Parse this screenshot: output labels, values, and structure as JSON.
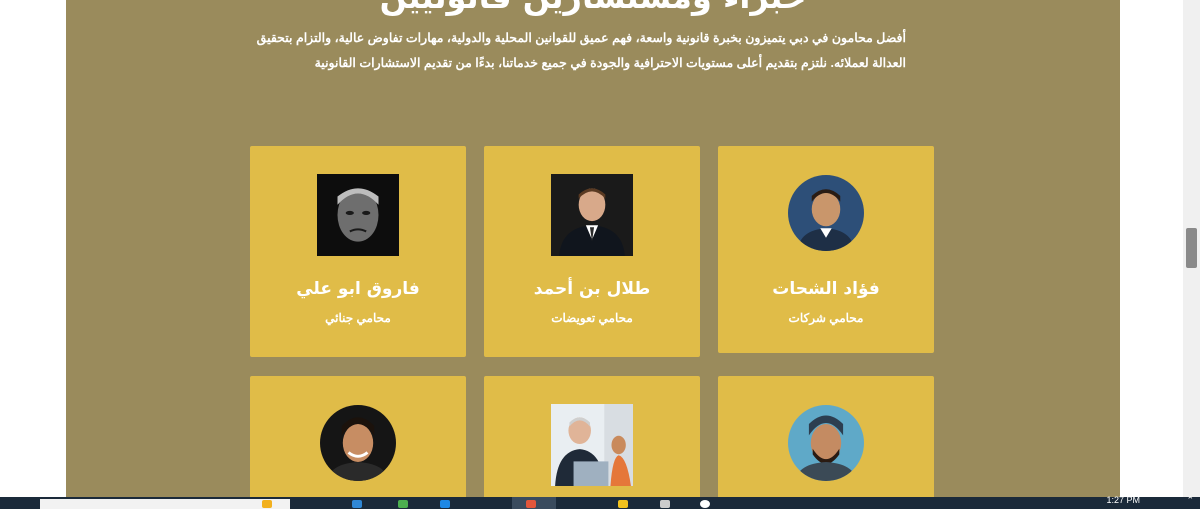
{
  "section": {
    "heading": "خبراء ومستشارين قانونيين",
    "intro_line1": "أفضل محامون في دبي يتميزون بخبرة قانونية واسعة، فهم عميق للقوانين المحلية والدولية، مهارات تفاوض عالية، والتزام بتحقيق",
    "intro_line2": "العدالة لعملائه. نلتزم بتقديم أعلى مستويات الاحترافية والجودة في جميع خدماتنا، بدءًا من تقديم الاستشارات القانونية",
    "background_color": "#9a8b5c",
    "card_color": "#e0bc48"
  },
  "lawyers": [
    {
      "name": "فؤاد الشحات",
      "role": "محامي شركات",
      "photo": "portrait-circle"
    },
    {
      "name": "طلال بن أحمد",
      "role": "محامي تعويضات",
      "photo": "portrait-square"
    },
    {
      "name": "فاروق ابو علي",
      "role": "محامي جنائي",
      "photo": "portrait-square-dark"
    },
    {
      "name": "",
      "role": "",
      "photo": "portrait-circle-beard"
    },
    {
      "name": "",
      "role": "",
      "photo": "portrait-square-office"
    },
    {
      "name": "",
      "role": "",
      "photo": "portrait-circle-smile"
    }
  ],
  "taskbar": {
    "clock": "1:27 PM"
  }
}
